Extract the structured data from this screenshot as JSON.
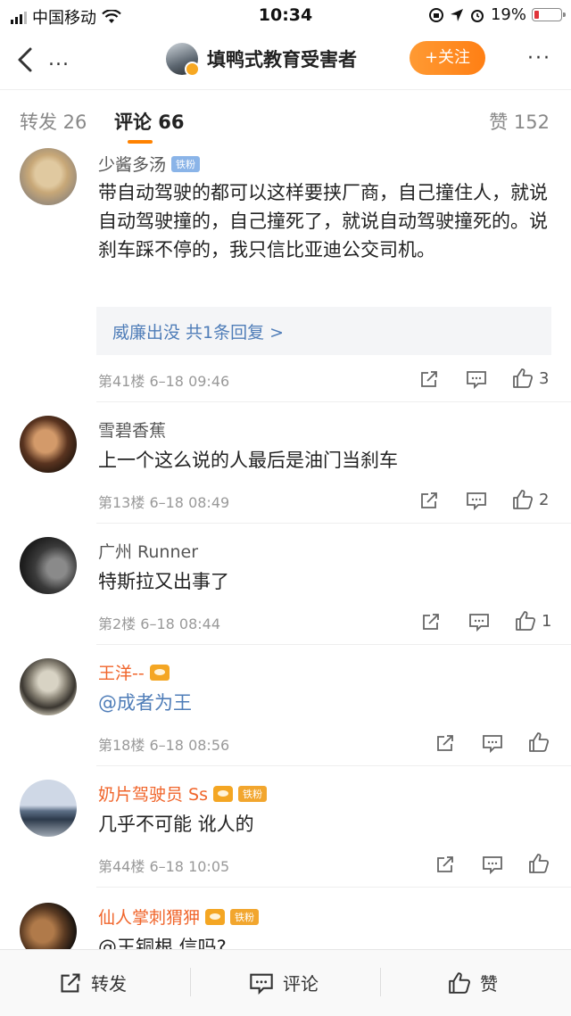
{
  "status": {
    "carrier": "中国移动",
    "time": "10:34",
    "battery": "19%",
    "battery_level": 0.19
  },
  "nav": {
    "more": "...",
    "title": "填鸭式教育受害者",
    "follow": "+关注",
    "menu": "···"
  },
  "tabs": {
    "repost": "转发 26",
    "comments": "评论 66",
    "likes": "赞 152"
  },
  "comments": [
    {
      "name": "少酱多汤",
      "badge": "铁粉",
      "text": "带自动驾驶的都可以这样要挟厂商，自己撞住人，就说自动驾驶撞的，自己撞死了，就说自动驾驶撞死的。说刹车踩不停的，我只信比亚迪公交司机。",
      "reply": "威廉出没  共1条回复 >",
      "meta": "第41楼 6–18 09:46",
      "likes": "3"
    },
    {
      "name": "雪碧香蕉",
      "text": "上一个这么说的人最后是油门当刹车",
      "meta": "第13楼 6–18 08:49",
      "likes": "2"
    },
    {
      "name": "广州 Runner",
      "text": "特斯拉又出事了",
      "meta": "第2楼 6–18 08:44",
      "likes": "1"
    },
    {
      "name": "王洋--",
      "text": "@成者为王",
      "meta": "第18楼 6–18 08:56",
      "likes": ""
    },
    {
      "name": "奶片驾驶员 Ss",
      "badge": "铁粉",
      "text": "几乎不可能 讹人的",
      "meta": "第44楼 6–18 10:05",
      "likes": ""
    },
    {
      "name": "仙人掌刺猬狎",
      "badge": "铁粉",
      "text": "@王铜根 信吗?"
    }
  ],
  "bottom": {
    "repost": "转发",
    "comment": "评论",
    "like": "赞"
  }
}
